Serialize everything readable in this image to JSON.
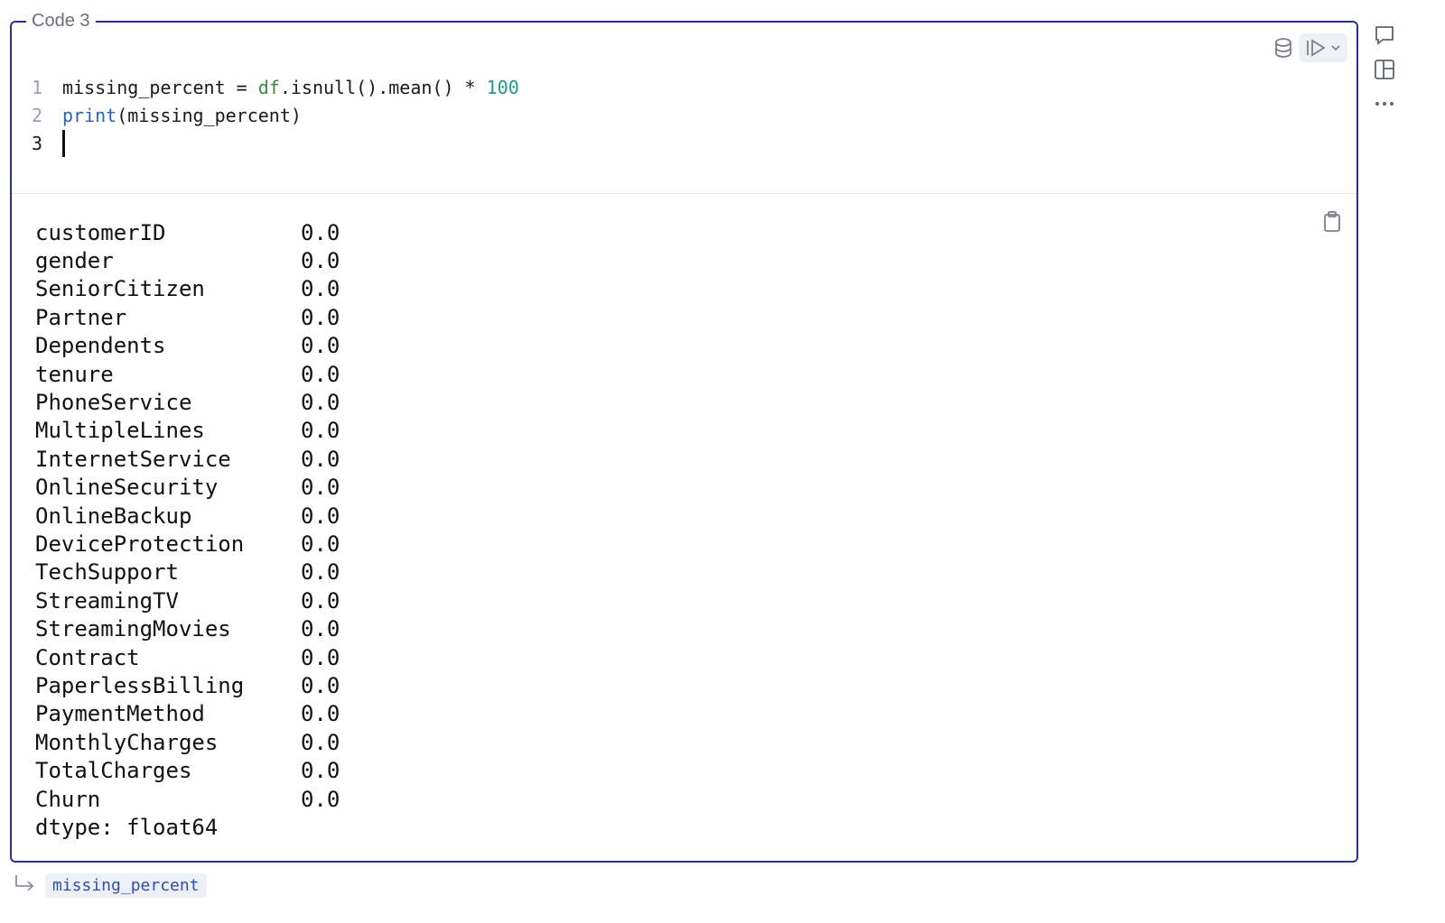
{
  "cell": {
    "label": "Code 3",
    "code_lines": [
      {
        "number": "1",
        "parts": [
          {
            "text": "missing_percent = ",
            "kind": "plain"
          },
          {
            "text": "df",
            "kind": "var"
          },
          {
            "text": ".isnull().mean() * ",
            "kind": "plain"
          },
          {
            "text": "100",
            "kind": "num"
          }
        ]
      },
      {
        "number": "2",
        "parts": [
          {
            "text": "print",
            "kind": "fn"
          },
          {
            "text": "(missing_percent)",
            "kind": "plain"
          }
        ]
      },
      {
        "number": "3",
        "parts": []
      }
    ],
    "output": {
      "rows": [
        {
          "name": "customerID",
          "value": "0.0"
        },
        {
          "name": "gender",
          "value": "0.0"
        },
        {
          "name": "SeniorCitizen",
          "value": "0.0"
        },
        {
          "name": "Partner",
          "value": "0.0"
        },
        {
          "name": "Dependents",
          "value": "0.0"
        },
        {
          "name": "tenure",
          "value": "0.0"
        },
        {
          "name": "PhoneService",
          "value": "0.0"
        },
        {
          "name": "MultipleLines",
          "value": "0.0"
        },
        {
          "name": "InternetService",
          "value": "0.0"
        },
        {
          "name": "OnlineSecurity",
          "value": "0.0"
        },
        {
          "name": "OnlineBackup",
          "value": "0.0"
        },
        {
          "name": "DeviceProtection",
          "value": "0.0"
        },
        {
          "name": "TechSupport",
          "value": "0.0"
        },
        {
          "name": "StreamingTV",
          "value": "0.0"
        },
        {
          "name": "StreamingMovies",
          "value": "0.0"
        },
        {
          "name": "Contract",
          "value": "0.0"
        },
        {
          "name": "PaperlessBilling",
          "value": "0.0"
        },
        {
          "name": "PaymentMethod",
          "value": "0.0"
        },
        {
          "name": "MonthlyCharges",
          "value": "0.0"
        },
        {
          "name": "TotalCharges",
          "value": "0.0"
        },
        {
          "name": "Churn",
          "value": "0.0"
        }
      ],
      "dtype_line": "dtype: float64"
    }
  },
  "footer": {
    "variable": "missing_percent"
  },
  "icons": {
    "database": "database-icon",
    "run": "run-icon",
    "dropdown": "chevron-down-icon",
    "copy": "clipboard-icon",
    "comment": "comment-icon",
    "layout": "layout-icon",
    "more": "more-icon",
    "return": "return-arrow-icon"
  },
  "colors": {
    "cell_border": "#2d2f8f",
    "variable": "#3a8a3e",
    "function": "#2b64c6",
    "number": "#1f9a8a",
    "chip_text": "#2f4fa8"
  }
}
